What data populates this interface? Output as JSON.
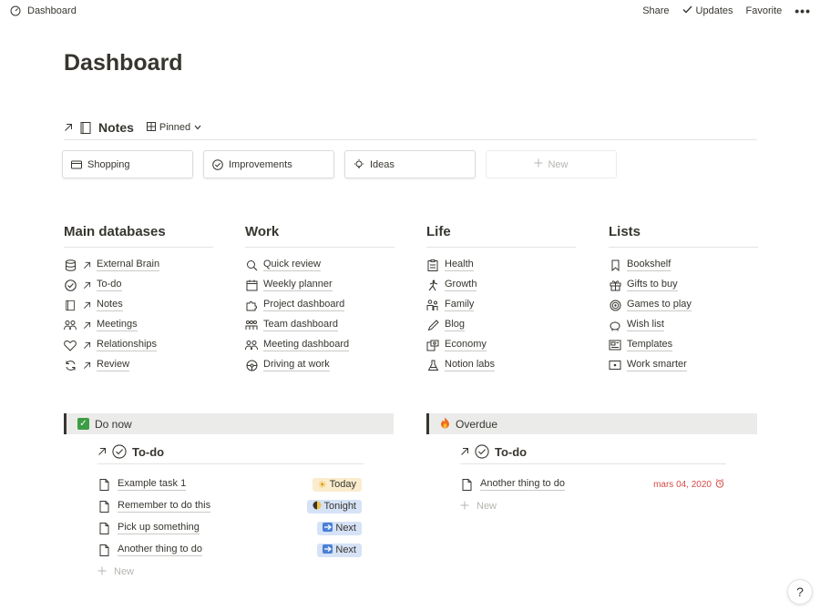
{
  "topbar": {
    "crumb": "Dashboard",
    "share": "Share",
    "updates": "Updates",
    "favorite": "Favorite",
    "more": "•••"
  },
  "page": {
    "title": "Dashboard"
  },
  "notes": {
    "title": "Notes",
    "view": "Pinned",
    "cards": [
      {
        "label": "Shopping",
        "icon": "credit-card-icon"
      },
      {
        "label": "Improvements",
        "icon": "check-circle-icon"
      },
      {
        "label": "Ideas",
        "icon": "lightbulb-icon"
      }
    ],
    "new_label": "New"
  },
  "columns": [
    {
      "title": "Main databases",
      "items": [
        {
          "label": "External Brain",
          "icon": "database-icon"
        },
        {
          "label": "To-do",
          "icon": "check-circle-icon"
        },
        {
          "label": "Notes",
          "icon": "book-icon"
        },
        {
          "label": "Meetings",
          "icon": "people-icon"
        },
        {
          "label": "Relationships",
          "icon": "heart-handshake-icon"
        },
        {
          "label": "Review",
          "icon": "refresh-icon"
        }
      ]
    },
    {
      "title": "Work",
      "items": [
        {
          "label": "Quick review",
          "icon": "magnifier-icon"
        },
        {
          "label": "Weekly planner",
          "icon": "calendar-icon"
        },
        {
          "label": "Project dashboard",
          "icon": "puzzle-icon"
        },
        {
          "label": "Team dashboard",
          "icon": "team-icon"
        },
        {
          "label": "Meeting dashboard",
          "icon": "people-icon"
        },
        {
          "label": "Driving at work",
          "icon": "steering-wheel-icon"
        }
      ]
    },
    {
      "title": "Life",
      "items": [
        {
          "label": "Health",
          "icon": "clipboard-icon"
        },
        {
          "label": "Growth",
          "icon": "figure-icon"
        },
        {
          "label": "Family",
          "icon": "family-icon"
        },
        {
          "label": "Blog",
          "icon": "pencil-icon"
        },
        {
          "label": "Economy",
          "icon": "money-icon"
        },
        {
          "label": "Notion labs",
          "icon": "flask-icon"
        }
      ]
    },
    {
      "title": "Lists",
      "items": [
        {
          "label": "Bookshelf",
          "icon": "bookmark-icon"
        },
        {
          "label": "Gifts to buy",
          "icon": "gift-icon"
        },
        {
          "label": "Games to play",
          "icon": "target-icon"
        },
        {
          "label": "Wish list",
          "icon": "piggy-bank-icon"
        },
        {
          "label": "Templates",
          "icon": "newspaper-icon"
        },
        {
          "label": "Work smarter",
          "icon": "screen-icon"
        }
      ]
    }
  ],
  "do_now": {
    "callout": "Do now",
    "db_title": "To-do",
    "tasks": [
      {
        "name": "Example task 1",
        "tag": "Today",
        "tag_icon": "sun-icon"
      },
      {
        "name": "Remember to do this",
        "tag": "Tonight",
        "tag_icon": "moon-icon"
      },
      {
        "name": "Pick up something",
        "tag": "Next",
        "tag_icon": "right-arrow-icon"
      },
      {
        "name": "Another thing to do",
        "tag": "Next",
        "tag_icon": "right-arrow-icon"
      }
    ],
    "new_label": "New"
  },
  "overdue": {
    "callout": "Overdue",
    "db_title": "To-do",
    "tasks": [
      {
        "name": "Another thing to do",
        "date": "mars 04, 2020"
      }
    ],
    "new_label": "New"
  },
  "help": "?",
  "colors": {
    "text": "#37352f",
    "muted": "#b4b4b0",
    "today_bg": "#fbeccd",
    "tag_bg": "#d6e2f6",
    "due_red": "#d44c47",
    "check_green": "#3e9d44"
  }
}
